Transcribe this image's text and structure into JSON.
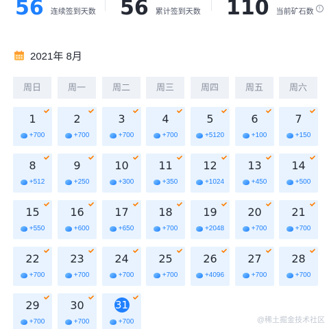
{
  "stats": [
    {
      "value": "56",
      "label": "连续签到天数"
    },
    {
      "value": "56",
      "label": "累计签到天数"
    },
    {
      "value": "110",
      "label": "当前矿石数"
    }
  ],
  "info_icon_glyph": "!",
  "month_title": "2021年 8月",
  "weekdays": [
    "周日",
    "周一",
    "周二",
    "周三",
    "周四",
    "周五",
    "周六"
  ],
  "days": [
    {
      "day": "1",
      "points": "+700"
    },
    {
      "day": "2",
      "points": "+700"
    },
    {
      "day": "3",
      "points": "+700"
    },
    {
      "day": "4",
      "points": "+700"
    },
    {
      "day": "5",
      "points": "+5120"
    },
    {
      "day": "6",
      "points": "+100"
    },
    {
      "day": "7",
      "points": "+150"
    },
    {
      "day": "8",
      "points": "+512"
    },
    {
      "day": "9",
      "points": "+250"
    },
    {
      "day": "10",
      "points": "+300"
    },
    {
      "day": "11",
      "points": "+350"
    },
    {
      "day": "12",
      "points": "+1024"
    },
    {
      "day": "13",
      "points": "+450"
    },
    {
      "day": "14",
      "points": "+500"
    },
    {
      "day": "15",
      "points": "+550"
    },
    {
      "day": "16",
      "points": "+600"
    },
    {
      "day": "17",
      "points": "+650"
    },
    {
      "day": "18",
      "points": "+700"
    },
    {
      "day": "19",
      "points": "+2048"
    },
    {
      "day": "20",
      "points": "+700"
    },
    {
      "day": "21",
      "points": "+700"
    },
    {
      "day": "22",
      "points": "+700"
    },
    {
      "day": "23",
      "points": "+700"
    },
    {
      "day": "24",
      "points": "+700"
    },
    {
      "day": "25",
      "points": "+700"
    },
    {
      "day": "26",
      "points": "+4096"
    },
    {
      "day": "27",
      "points": "+700"
    },
    {
      "day": "28",
      "points": "+700"
    },
    {
      "day": "29",
      "points": "+700"
    },
    {
      "day": "30",
      "points": "+700"
    },
    {
      "day": "31",
      "points": "+700",
      "today": true
    }
  ],
  "watermark": "@稀土掘金技术社区",
  "colors": {
    "accent": "#1e80ff",
    "cell_bg": "#e8f3ff",
    "header_bg": "#eef1f6",
    "check": "#ff7d00",
    "calendar_icon": "#ffb84d"
  }
}
